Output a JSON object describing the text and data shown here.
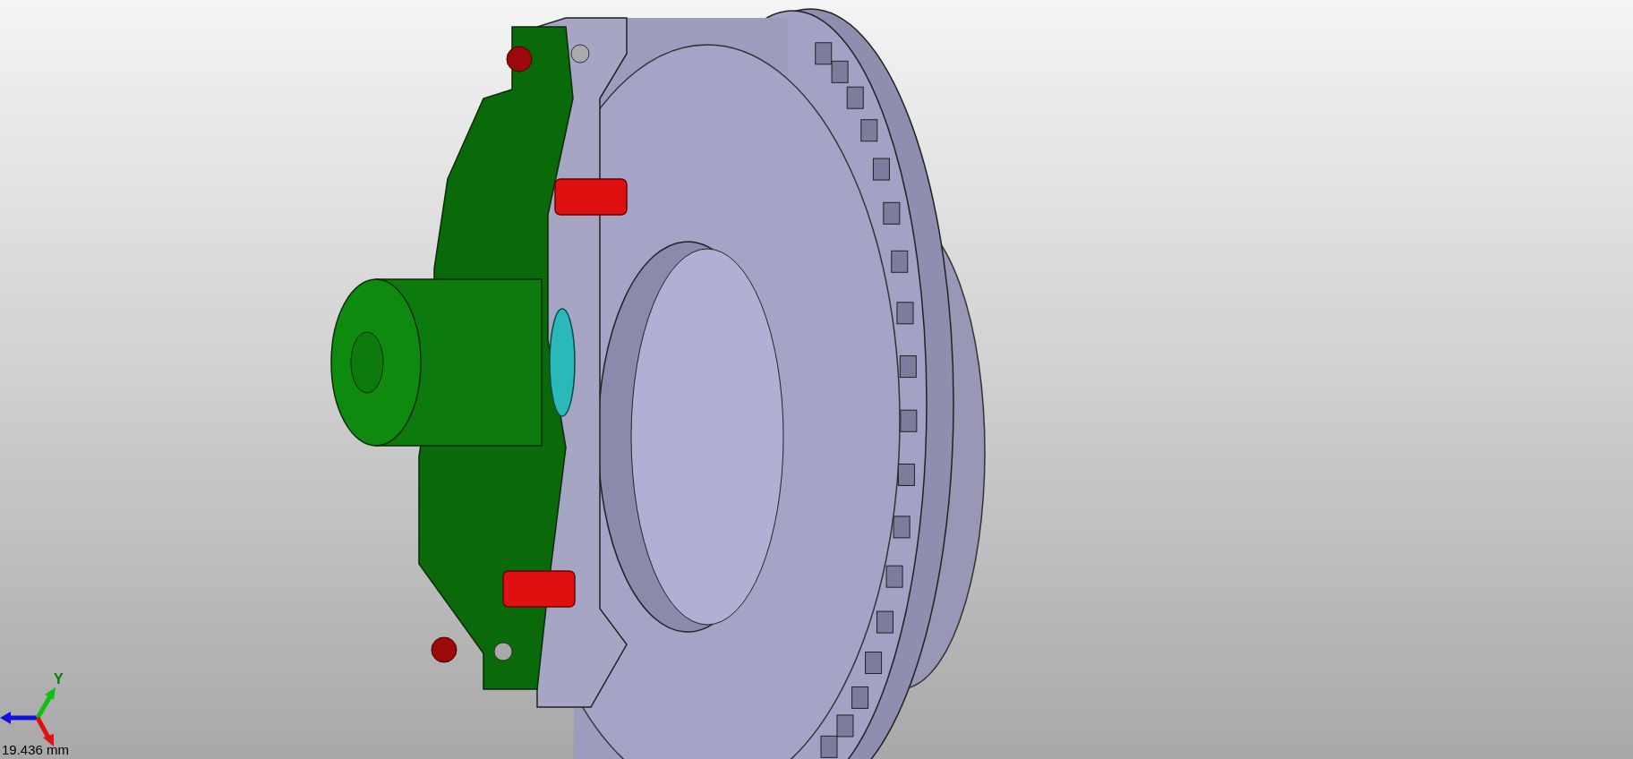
{
  "viewport": {
    "axis_label": "Y",
    "scale_label": "19.436 mm"
  }
}
